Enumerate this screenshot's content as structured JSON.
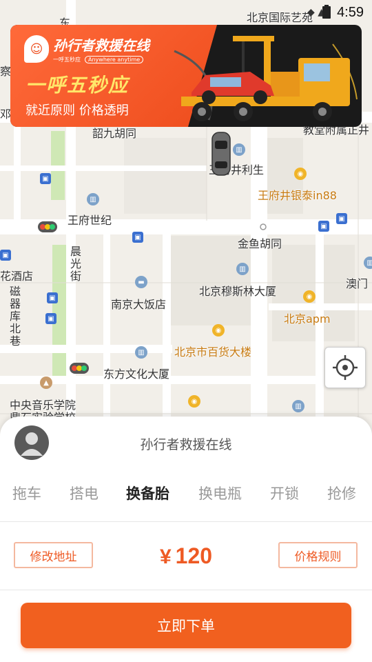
{
  "status_bar": {
    "time": "4:59"
  },
  "banner": {
    "brand_name": "孙行者救援在线",
    "brand_sub": "一呼五秒应",
    "brand_en": "Anywhere anytime",
    "slogan": "一呼五秒应",
    "tagline": "就近原则  价格透明",
    "accent": "#ee4d1d"
  },
  "map": {
    "labels": {
      "l1": "北京国际艺苑",
      "l2": "韶九胡同",
      "l3": "教堂附属正井",
      "l4": "王府井利生",
      "l5": "王府井银泰in88",
      "l6": "王府世纪",
      "l7": "金鱼胡同",
      "l8": "花酒店",
      "l9": "晨光街",
      "l10": "南京大饭店",
      "l11": "北京穆斯林大厦",
      "l12": "澳门",
      "l13": "北京apm",
      "l14": "磁器库北巷",
      "l15": "北京市百货大楼",
      "l16": "东方文化大厦",
      "l17": "中央音乐学院",
      "l18": "鼎石实验学校",
      "l19": "东",
      "l20": "察",
      "l21": "邓"
    }
  },
  "sheet": {
    "title": "孙行者救援在线",
    "tabs": [
      {
        "label": "拖车"
      },
      {
        "label": "搭电"
      },
      {
        "label": "换备胎"
      },
      {
        "label": "换电瓶"
      },
      {
        "label": "开锁"
      },
      {
        "label": "抢修"
      }
    ],
    "active_tab": "换备胎",
    "edit_address": "修改地址",
    "currency": "¥",
    "price": "120",
    "price_rules": "价格规则",
    "order_button": "立即下单",
    "accent": "#f1601f"
  }
}
